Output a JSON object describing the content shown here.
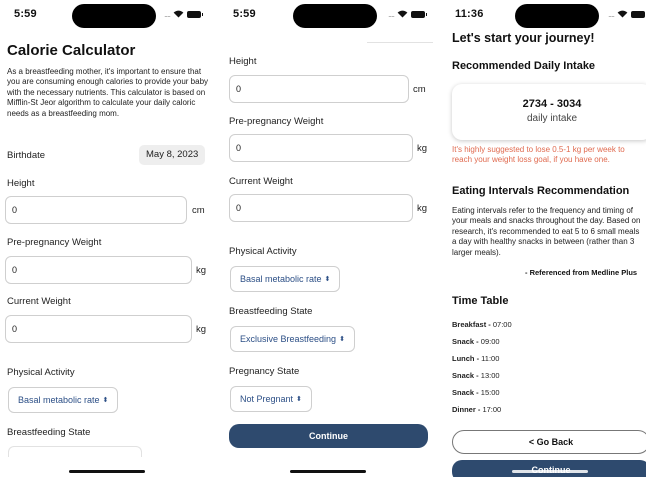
{
  "screen1": {
    "status_time": "5:59",
    "title": "Calorie Calculator",
    "description": "As a breastfeeding mother, it's important to ensure that you are consuming enough calories to provide your baby with the necessary nutrients. This calculator is based on Mifflin-St Jeor algorithm to calculate your daily caloric needs as a breastfeeding mom.",
    "birthdate_label": "Birthdate",
    "birthdate_value": "May 8, 2023",
    "height_label": "Height",
    "height_value": "0",
    "height_unit": "cm",
    "pre_weight_label": "Pre-pregnancy Weight",
    "pre_weight_value": "0",
    "pre_weight_unit": "kg",
    "cur_weight_label": "Current Weight",
    "cur_weight_value": "0",
    "cur_weight_unit": "kg",
    "activity_label": "Physical Activity",
    "activity_value": "Basal metabolic rate",
    "breastfeeding_label": "Breastfeeding State"
  },
  "screen2": {
    "status_time": "5:59",
    "height_label": "Height",
    "height_value": "0",
    "height_unit": "cm",
    "pre_weight_label": "Pre-pregnancy Weight",
    "pre_weight_value": "0",
    "pre_weight_unit": "kg",
    "cur_weight_label": "Current Weight",
    "cur_weight_value": "0",
    "cur_weight_unit": "kg",
    "activity_label": "Physical Activity",
    "activity_value": "Basal metabolic rate",
    "breastfeeding_label": "Breastfeeding State",
    "breastfeeding_value": "Exclusive Breastfeeding",
    "pregnancy_label": "Pregnancy State",
    "pregnancy_value": "Not Pregnant",
    "continue_label": "Continue"
  },
  "screen3": {
    "status_time": "11:36",
    "title": "Let's start your journey!",
    "intake_heading": "Recommended Daily Intake",
    "intake_range": "2734 - 3034",
    "intake_caption": "daily intake",
    "warning": "It's highly suggested to lose 0.5-1 kg per week to reach your weight loss goal, if you have one.",
    "intervals_heading": "Eating Intervals Recommendation",
    "intervals_text": "Eating intervals refer to the frequency and timing of your meals and snacks throughout the day. Based on research, it's recommended to eat 5 to 6 small meals a day with healthy snacks in between (rather than 3 larger meals).",
    "reference": "- Referenced from Medline Plus",
    "timetable_heading": "Time Table",
    "timetable": [
      {
        "meal": "Breakfast -",
        "time": "07:00"
      },
      {
        "meal": "Snack -",
        "time": "09:00"
      },
      {
        "meal": "Lunch -",
        "time": "11:00"
      },
      {
        "meal": "Snack -",
        "time": "13:00"
      },
      {
        "meal": "Snack -",
        "time": "15:00"
      },
      {
        "meal": "Dinner -",
        "time": "17:00"
      }
    ],
    "back_label": "< Go Back",
    "continue_label": "Continue"
  }
}
